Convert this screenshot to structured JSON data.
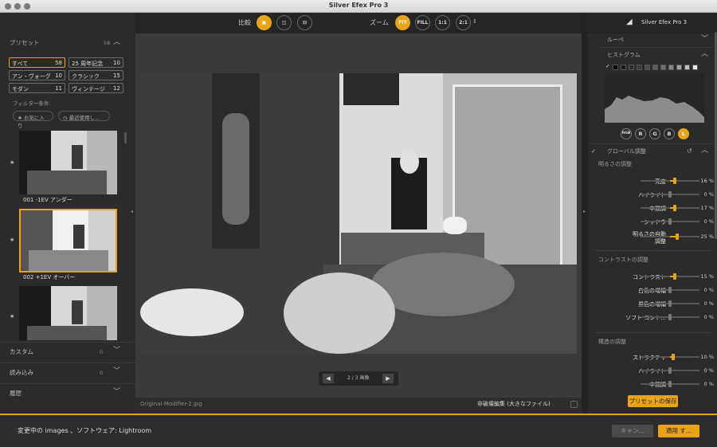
{
  "window": {
    "title": "Silver Efex Pro 3"
  },
  "left": {
    "presets_label": "プリセット",
    "presets_count": "58",
    "presets": [
      {
        "label": "すべて",
        "count": "58"
      },
      {
        "label": "25 周年記念",
        "count": "10"
      },
      {
        "label": "アン・ヴォーグ",
        "count": "10"
      },
      {
        "label": "クラシック",
        "count": "15"
      },
      {
        "label": "モダン",
        "count": "11"
      },
      {
        "label": "ヴィンテージ",
        "count": "12"
      }
    ],
    "filter_label": "フィルター条件:",
    "filter_favorites": "お気に入り",
    "filter_recent": "最近使用し...",
    "thumbs": [
      {
        "label": "001 -1EV アンダー"
      },
      {
        "label": "002 +1EV オーバー"
      }
    ],
    "custom_label": "カスタム",
    "custom_count": "0",
    "import_label": "読み込み",
    "import_count": "0",
    "history_label": "履歴"
  },
  "toolbar": {
    "compare_label": "比較",
    "zoom_label": "ズーム",
    "zoom_fit": "FIT",
    "zoom_fill": "FILL",
    "zoom_1": "1:1",
    "zoom_2": "2:1"
  },
  "nav": {
    "page": "2 / 3 画像"
  },
  "footer": {
    "filename": "Original-Modifier-2.jpg",
    "edit_mode": "非破壊編集 (大きなファイル)"
  },
  "right": {
    "brand": "Silver Efex Pro 3",
    "loupe": "ルーペ",
    "histogram": "ヒストグラム",
    "channels": [
      "RGB",
      "R",
      "G",
      "B",
      "L"
    ],
    "global": "グローバル調整",
    "brightness_section": "明るさの調整",
    "contrast_section": "コントラストの調整",
    "structure_section": "構造の調整",
    "save_preset": "プリセットの保存",
    "sliders": [
      {
        "label": "亮度",
        "value": "16 %",
        "pct": 16
      },
      {
        "label": "ハイライト",
        "value": "0 %",
        "pct": 0
      },
      {
        "label": "中間調",
        "value": "17 %",
        "pct": 17
      },
      {
        "label": "シャドウ",
        "value": "0 %",
        "pct": 0
      },
      {
        "label": "明るさの自動調整",
        "value": "25 %",
        "pct": 25
      },
      {
        "label": "コントラスト",
        "value": "15 %",
        "pct": 15
      },
      {
        "label": "白色の増幅",
        "value": "0 %",
        "pct": 0
      },
      {
        "label": "黒色の増幅",
        "value": "0 %",
        "pct": 0
      },
      {
        "label": "ソフト コント...",
        "value": "0 %",
        "pct": 0
      },
      {
        "label": "ストラクチャ",
        "value": "10 %",
        "pct": 10
      },
      {
        "label": "ハイライト",
        "value": "0 %",
        "pct": 0
      },
      {
        "label": "中間調",
        "value": "0 %",
        "pct": 0
      }
    ]
  },
  "bottom": {
    "status": "変更中の images 、ソフトウェア: Lightroom",
    "cancel": "キャン...",
    "apply": "適用 す..."
  },
  "colors": {
    "accent": "#e8a317",
    "panel": "#2b2b2b",
    "canvas": "#3a3a3a"
  }
}
